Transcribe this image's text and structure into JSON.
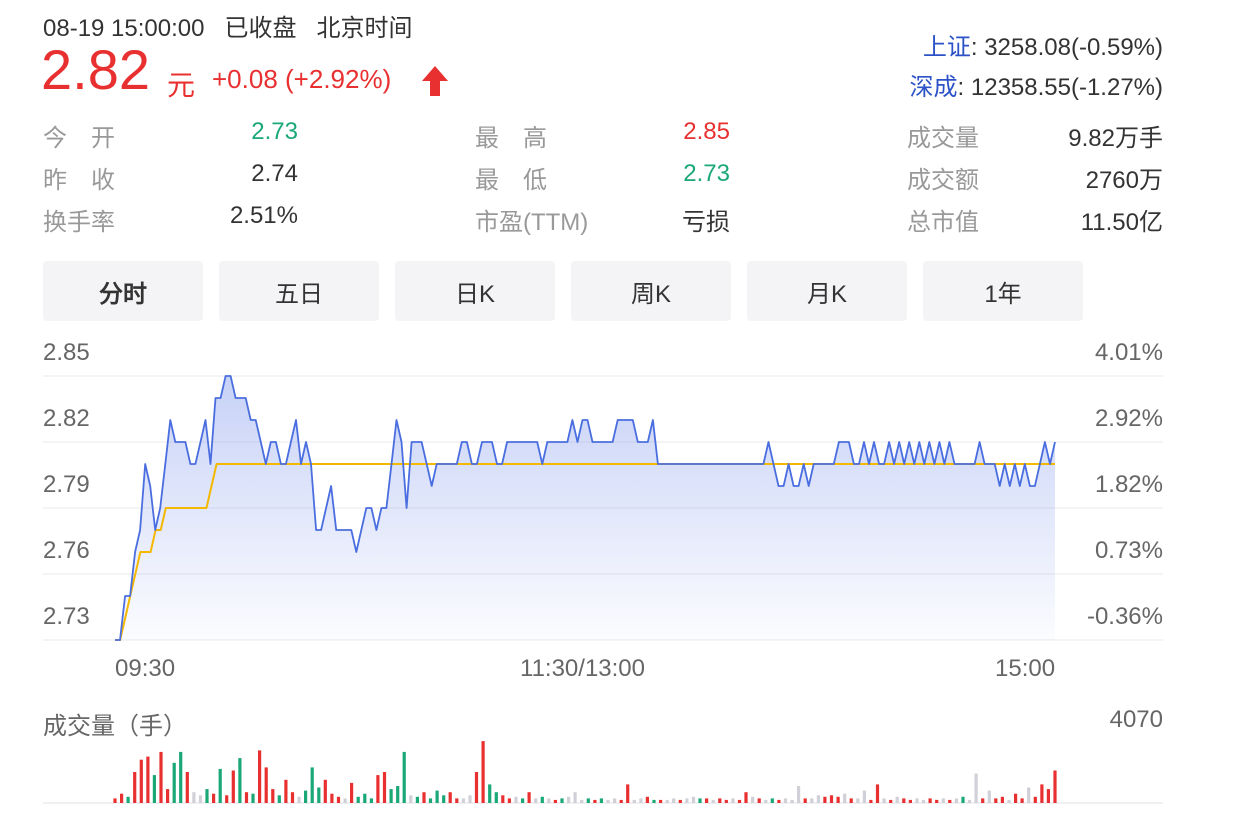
{
  "header": {
    "datetime": "08-19 15:00:00",
    "status": "已收盘",
    "timezone": "北京时间"
  },
  "quote": {
    "price": "2.82",
    "unit": "元",
    "change": "+0.08 (+2.92%)",
    "direction": "up"
  },
  "indices": [
    {
      "name": "上证",
      "value": ": 3258.08(-0.59%)"
    },
    {
      "name": "深成",
      "value": ": 12358.55(-1.27%)"
    }
  ],
  "stats": [
    {
      "label": "今　开",
      "value": "2.73",
      "color": "green"
    },
    {
      "label": "最　高",
      "value": "2.85",
      "color": "red"
    },
    {
      "label": "成交量",
      "value": "9.82万手",
      "color": "dark"
    },
    {
      "label": "昨　收",
      "value": "2.74",
      "color": "dark"
    },
    {
      "label": "最　低",
      "value": "2.73",
      "color": "green"
    },
    {
      "label": "成交额",
      "value": "2760万",
      "color": "dark"
    },
    {
      "label": "换手率",
      "value": "2.51%",
      "color": "dark"
    },
    {
      "label": "市盈(TTM)",
      "value": "亏损",
      "color": "dark"
    },
    {
      "label": "总市值",
      "value": "11.50亿",
      "color": "dark"
    }
  ],
  "tabs": [
    {
      "label": "分时",
      "active": true
    },
    {
      "label": "五日",
      "active": false
    },
    {
      "label": "日K",
      "active": false
    },
    {
      "label": "周K",
      "active": false
    },
    {
      "label": "月K",
      "active": false
    },
    {
      "label": "1年",
      "active": false
    }
  ],
  "colors": {
    "up": "#e93030",
    "down": "#1aa877",
    "price_line": "#4a6ee0",
    "avg_line": "#f5b800",
    "neutral_bar": "#d0d0d8"
  },
  "chart_data": {
    "type": "line",
    "title": "",
    "price_ticks": [
      "2.85",
      "2.82",
      "2.79",
      "2.76",
      "2.73"
    ],
    "pct_ticks": [
      "4.01%",
      "2.92%",
      "1.82%",
      "0.73%",
      "-0.36%"
    ],
    "ylim": [
      2.73,
      2.85
    ],
    "x_ticks": [
      "09:30",
      "11:30/13:00",
      "15:00"
    ],
    "grid": true,
    "series": [
      {
        "values": [
          2.73,
          2.73,
          2.75,
          2.75,
          2.77,
          2.78,
          2.81,
          2.8,
          2.78,
          2.79,
          2.81,
          2.83,
          2.82,
          2.82,
          2.82,
          2.81,
          2.81,
          2.82,
          2.83,
          2.81,
          2.84,
          2.84,
          2.85,
          2.85,
          2.84,
          2.84,
          2.84,
          2.83,
          2.83,
          2.82,
          2.81,
          2.82,
          2.82,
          2.81,
          2.81,
          2.82,
          2.83,
          2.81,
          2.82,
          2.81,
          2.78,
          2.78,
          2.79,
          2.8,
          2.78,
          2.78,
          2.78,
          2.78,
          2.77,
          2.78,
          2.79,
          2.79,
          2.78,
          2.79,
          2.79,
          2.81,
          2.83,
          2.82,
          2.79,
          2.82,
          2.82,
          2.82,
          2.81,
          2.8,
          2.81,
          2.81,
          2.81,
          2.81,
          2.81,
          2.82,
          2.82,
          2.81,
          2.81,
          2.82,
          2.82,
          2.82,
          2.81,
          2.81,
          2.82,
          2.82,
          2.82,
          2.82,
          2.82,
          2.82,
          2.82,
          2.81,
          2.82,
          2.82,
          2.82,
          2.82,
          2.82,
          2.83,
          2.82,
          2.83,
          2.83,
          2.82,
          2.82,
          2.82,
          2.82,
          2.82,
          2.83,
          2.83,
          2.83,
          2.83,
          2.82,
          2.82,
          2.82,
          2.83,
          2.81,
          2.81,
          2.81,
          2.81,
          2.81,
          2.81,
          2.81,
          2.81,
          2.81,
          2.81,
          2.81,
          2.81,
          2.81,
          2.81,
          2.81,
          2.81,
          2.81,
          2.81,
          2.81,
          2.81,
          2.81,
          2.81,
          2.82,
          2.81,
          2.8,
          2.8,
          2.81,
          2.8,
          2.8,
          2.81,
          2.8,
          2.81,
          2.81,
          2.81,
          2.81,
          2.81,
          2.82,
          2.82,
          2.82,
          2.81,
          2.81,
          2.82,
          2.81,
          2.82,
          2.81,
          2.81,
          2.82,
          2.81,
          2.82,
          2.81,
          2.82,
          2.81,
          2.82,
          2.81,
          2.82,
          2.81,
          2.82,
          2.81,
          2.82,
          2.81,
          2.81,
          2.81,
          2.81,
          2.81,
          2.82,
          2.81,
          2.81,
          2.81,
          2.8,
          2.81,
          2.8,
          2.81,
          2.8,
          2.81,
          2.8,
          2.8,
          2.81,
          2.82,
          2.81,
          2.82
        ]
      },
      {
        "values": [
          2.73,
          2.73,
          2.74,
          2.75,
          2.76,
          2.77,
          2.77,
          2.77,
          2.78,
          2.78,
          2.79,
          2.79,
          2.79,
          2.79,
          2.79,
          2.79,
          2.79,
          2.79,
          2.79,
          2.8,
          2.81,
          2.81,
          2.81,
          2.81,
          2.81,
          2.81,
          2.81,
          2.81,
          2.81,
          2.81,
          2.81,
          2.81,
          2.81,
          2.81,
          2.81,
          2.81,
          2.81,
          2.81,
          2.81,
          2.81,
          2.81,
          2.81,
          2.81,
          2.81,
          2.81,
          2.81,
          2.81,
          2.81,
          2.81,
          2.81,
          2.81,
          2.81,
          2.81,
          2.81,
          2.81,
          2.81,
          2.81,
          2.81,
          2.81,
          2.81,
          2.81,
          2.81,
          2.81,
          2.81,
          2.81,
          2.81,
          2.81,
          2.81,
          2.81,
          2.81,
          2.81,
          2.81,
          2.81,
          2.81,
          2.81,
          2.81,
          2.81,
          2.81,
          2.81,
          2.81,
          2.81,
          2.81,
          2.81,
          2.81,
          2.81,
          2.81,
          2.81,
          2.81,
          2.81,
          2.81,
          2.81,
          2.81,
          2.81,
          2.81,
          2.81,
          2.81,
          2.81,
          2.81,
          2.81,
          2.81,
          2.81,
          2.81,
          2.81,
          2.81,
          2.81,
          2.81,
          2.81,
          2.81,
          2.81,
          2.81,
          2.81,
          2.81,
          2.81,
          2.81,
          2.81,
          2.81,
          2.81,
          2.81,
          2.81,
          2.81,
          2.81,
          2.81,
          2.81,
          2.81,
          2.81,
          2.81,
          2.81,
          2.81,
          2.81,
          2.81,
          2.81,
          2.81,
          2.81,
          2.81,
          2.81,
          2.81,
          2.81,
          2.81,
          2.81,
          2.81,
          2.81,
          2.81,
          2.81,
          2.81,
          2.81,
          2.81,
          2.81,
          2.81,
          2.81,
          2.81,
          2.81,
          2.81,
          2.81,
          2.81,
          2.81,
          2.81,
          2.81,
          2.81,
          2.81,
          2.81,
          2.81,
          2.81,
          2.81,
          2.81,
          2.81,
          2.81,
          2.81,
          2.81,
          2.81,
          2.81,
          2.81,
          2.81,
          2.81,
          2.81,
          2.81,
          2.81,
          2.81,
          2.81,
          2.81,
          2.81,
          2.81,
          2.81,
          2.81,
          2.81,
          2.81,
          2.81
        ]
      }
    ]
  },
  "volume": {
    "label": "成交量（手）",
    "max_label": "4070",
    "max": 4070,
    "bars": [
      {
        "v": 300,
        "c": "up"
      },
      {
        "v": 600,
        "c": "up"
      },
      {
        "v": 400,
        "c": "down"
      },
      {
        "v": 2000,
        "c": "up"
      },
      {
        "v": 2800,
        "c": "up"
      },
      {
        "v": 3000,
        "c": "up"
      },
      {
        "v": 1800,
        "c": "down"
      },
      {
        "v": 3300,
        "c": "up"
      },
      {
        "v": 900,
        "c": "up"
      },
      {
        "v": 2600,
        "c": "down"
      },
      {
        "v": 3300,
        "c": "down"
      },
      {
        "v": 2000,
        "c": "up"
      },
      {
        "v": 700,
        "c": "neutral"
      },
      {
        "v": 500,
        "c": "neutral"
      },
      {
        "v": 900,
        "c": "down"
      },
      {
        "v": 600,
        "c": "up"
      },
      {
        "v": 2200,
        "c": "down"
      },
      {
        "v": 500,
        "c": "up"
      },
      {
        "v": 2100,
        "c": "up"
      },
      {
        "v": 2900,
        "c": "down"
      },
      {
        "v": 700,
        "c": "up"
      },
      {
        "v": 600,
        "c": "down"
      },
      {
        "v": 3400,
        "c": "up"
      },
      {
        "v": 2300,
        "c": "up"
      },
      {
        "v": 900,
        "c": "up"
      },
      {
        "v": 500,
        "c": "down"
      },
      {
        "v": 1500,
        "c": "up"
      },
      {
        "v": 700,
        "c": "up"
      },
      {
        "v": 400,
        "c": "neutral"
      },
      {
        "v": 800,
        "c": "down"
      },
      {
        "v": 2300,
        "c": "down"
      },
      {
        "v": 1000,
        "c": "down"
      },
      {
        "v": 1500,
        "c": "up"
      },
      {
        "v": 600,
        "c": "up"
      },
      {
        "v": 400,
        "c": "up"
      },
      {
        "v": 300,
        "c": "neutral"
      },
      {
        "v": 1300,
        "c": "up"
      },
      {
        "v": 400,
        "c": "down"
      },
      {
        "v": 600,
        "c": "down"
      },
      {
        "v": 300,
        "c": "down"
      },
      {
        "v": 1800,
        "c": "up"
      },
      {
        "v": 2000,
        "c": "up"
      },
      {
        "v": 900,
        "c": "down"
      },
      {
        "v": 1100,
        "c": "down"
      },
      {
        "v": 3300,
        "c": "down"
      },
      {
        "v": 500,
        "c": "neutral"
      },
      {
        "v": 400,
        "c": "down"
      },
      {
        "v": 700,
        "c": "up"
      },
      {
        "v": 300,
        "c": "down"
      },
      {
        "v": 800,
        "c": "down"
      },
      {
        "v": 500,
        "c": "down"
      },
      {
        "v": 700,
        "c": "up"
      },
      {
        "v": 300,
        "c": "up"
      },
      {
        "v": 300,
        "c": "neutral"
      },
      {
        "v": 500,
        "c": "neutral"
      },
      {
        "v": 2000,
        "c": "up"
      },
      {
        "v": 4000,
        "c": "up"
      },
      {
        "v": 1200,
        "c": "down"
      },
      {
        "v": 700,
        "c": "down"
      },
      {
        "v": 500,
        "c": "up"
      },
      {
        "v": 300,
        "c": "up"
      },
      {
        "v": 400,
        "c": "neutral"
      },
      {
        "v": 300,
        "c": "down"
      },
      {
        "v": 700,
        "c": "up"
      },
      {
        "v": 300,
        "c": "neutral"
      },
      {
        "v": 400,
        "c": "down"
      },
      {
        "v": 300,
        "c": "neutral"
      },
      {
        "v": 200,
        "c": "up"
      },
      {
        "v": 300,
        "c": "down"
      },
      {
        "v": 400,
        "c": "neutral"
      },
      {
        "v": 700,
        "c": "neutral"
      },
      {
        "v": 200,
        "c": "neutral"
      },
      {
        "v": 300,
        "c": "down"
      },
      {
        "v": 200,
        "c": "up"
      },
      {
        "v": 300,
        "c": "down"
      },
      {
        "v": 200,
        "c": "neutral"
      },
      {
        "v": 300,
        "c": "neutral"
      },
      {
        "v": 200,
        "c": "up"
      },
      {
        "v": 1200,
        "c": "up"
      },
      {
        "v": 200,
        "c": "neutral"
      },
      {
        "v": 300,
        "c": "neutral"
      },
      {
        "v": 400,
        "c": "up"
      },
      {
        "v": 200,
        "c": "down"
      },
      {
        "v": 200,
        "c": "up"
      },
      {
        "v": 200,
        "c": "neutral"
      },
      {
        "v": 300,
        "c": "neutral"
      },
      {
        "v": 200,
        "c": "up"
      },
      {
        "v": 300,
        "c": "neutral"
      },
      {
        "v": 400,
        "c": "neutral"
      },
      {
        "v": 300,
        "c": "down"
      },
      {
        "v": 300,
        "c": "up"
      },
      {
        "v": 200,
        "c": "neutral"
      },
      {
        "v": 300,
        "c": "up"
      },
      {
        "v": 200,
        "c": "up"
      },
      {
        "v": 300,
        "c": "neutral"
      },
      {
        "v": 200,
        "c": "up"
      },
      {
        "v": 700,
        "c": "up"
      },
      {
        "v": 400,
        "c": "neutral"
      },
      {
        "v": 300,
        "c": "up"
      },
      {
        "v": 200,
        "c": "neutral"
      },
      {
        "v": 300,
        "c": "down"
      },
      {
        "v": 200,
        "c": "up"
      },
      {
        "v": 300,
        "c": "neutral"
      },
      {
        "v": 200,
        "c": "neutral"
      },
      {
        "v": 1100,
        "c": "neutral"
      },
      {
        "v": 300,
        "c": "up"
      },
      {
        "v": 300,
        "c": "neutral"
      },
      {
        "v": 500,
        "c": "neutral"
      },
      {
        "v": 400,
        "c": "up"
      },
      {
        "v": 500,
        "c": "up"
      },
      {
        "v": 400,
        "c": "up"
      },
      {
        "v": 600,
        "c": "neutral"
      },
      {
        "v": 300,
        "c": "up"
      },
      {
        "v": 300,
        "c": "neutral"
      },
      {
        "v": 800,
        "c": "neutral"
      },
      {
        "v": 200,
        "c": "up"
      },
      {
        "v": 1200,
        "c": "up"
      },
      {
        "v": 300,
        "c": "neutral"
      },
      {
        "v": 200,
        "c": "up"
      },
      {
        "v": 400,
        "c": "neutral"
      },
      {
        "v": 300,
        "c": "up"
      },
      {
        "v": 200,
        "c": "up"
      },
      {
        "v": 300,
        "c": "neutral"
      },
      {
        "v": 200,
        "c": "neutral"
      },
      {
        "v": 300,
        "c": "up"
      },
      {
        "v": 200,
        "c": "up"
      },
      {
        "v": 300,
        "c": "neutral"
      },
      {
        "v": 200,
        "c": "up"
      },
      {
        "v": 300,
        "c": "neutral"
      },
      {
        "v": 400,
        "c": "down"
      },
      {
        "v": 200,
        "c": "neutral"
      },
      {
        "v": 1900,
        "c": "neutral"
      },
      {
        "v": 300,
        "c": "up"
      },
      {
        "v": 800,
        "c": "neutral"
      },
      {
        "v": 300,
        "c": "up"
      },
      {
        "v": 400,
        "c": "up"
      },
      {
        "v": 200,
        "c": "neutral"
      },
      {
        "v": 600,
        "c": "up"
      },
      {
        "v": 300,
        "c": "up"
      },
      {
        "v": 1000,
        "c": "neutral"
      },
      {
        "v": 400,
        "c": "up"
      },
      {
        "v": 1200,
        "c": "up"
      },
      {
        "v": 900,
        "c": "up"
      },
      {
        "v": 2100,
        "c": "up"
      }
    ]
  }
}
